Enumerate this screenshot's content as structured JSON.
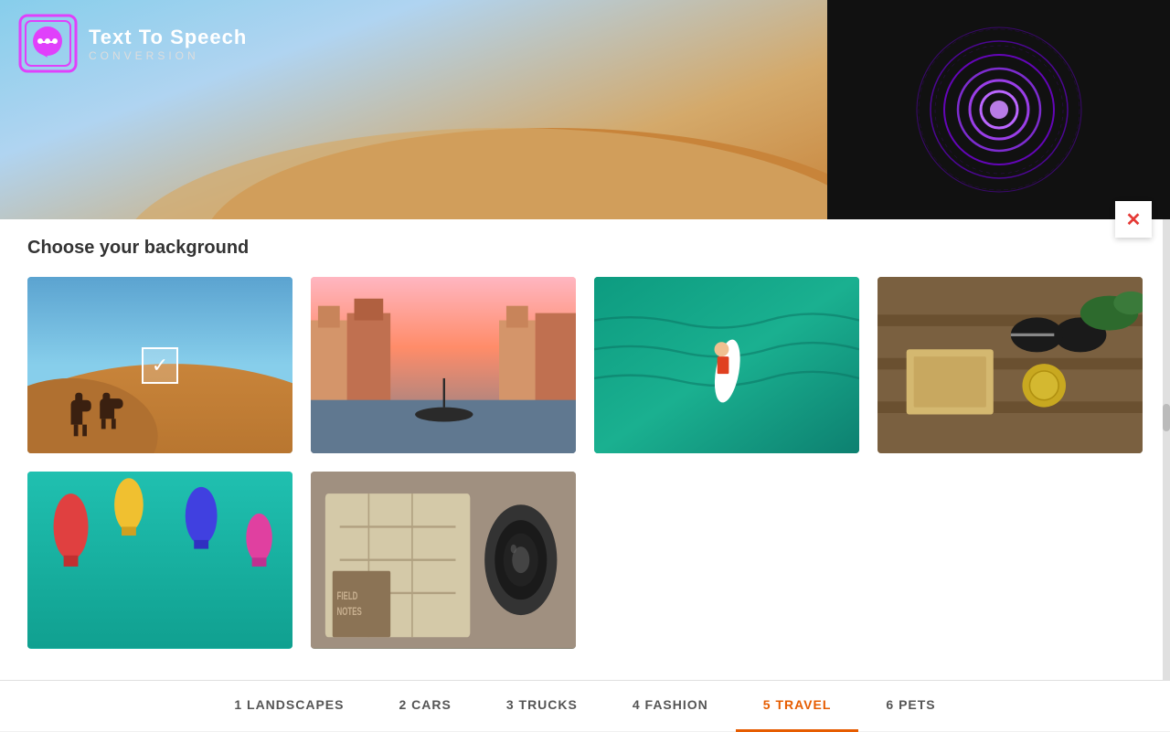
{
  "app": {
    "title": "Text To Speech",
    "subtitle": "CONVERSION"
  },
  "header": {
    "close_label": "✕"
  },
  "content": {
    "section_title": "Choose your background",
    "images": [
      {
        "id": 1,
        "label": "Desert with camels",
        "selected": true,
        "theme": "desert"
      },
      {
        "id": 2,
        "label": "Venice canal",
        "selected": false,
        "theme": "venice"
      },
      {
        "id": 3,
        "label": "Ocean surfboard aerial",
        "selected": false,
        "theme": "ocean"
      },
      {
        "id": 4,
        "label": "Travel flatlay",
        "selected": false,
        "theme": "flatlay"
      },
      {
        "id": 5,
        "label": "Teal ocean with balloons",
        "selected": false,
        "theme": "teal"
      },
      {
        "id": 6,
        "label": "Map and camera",
        "selected": false,
        "theme": "map"
      }
    ]
  },
  "tabs": [
    {
      "id": 1,
      "label": "1 LANDSCAPES",
      "active": false
    },
    {
      "id": 2,
      "label": "2 CARS",
      "active": false
    },
    {
      "id": 3,
      "label": "3 TRUCKS",
      "active": false
    },
    {
      "id": 4,
      "label": "4 FASHION",
      "active": false
    },
    {
      "id": 5,
      "label": "5 TRAVEL",
      "active": true
    },
    {
      "id": 6,
      "label": "6 PETS",
      "active": false
    }
  ],
  "colors": {
    "active_tab": "#e65c00",
    "active_tab_bg": "#fff3e0"
  }
}
